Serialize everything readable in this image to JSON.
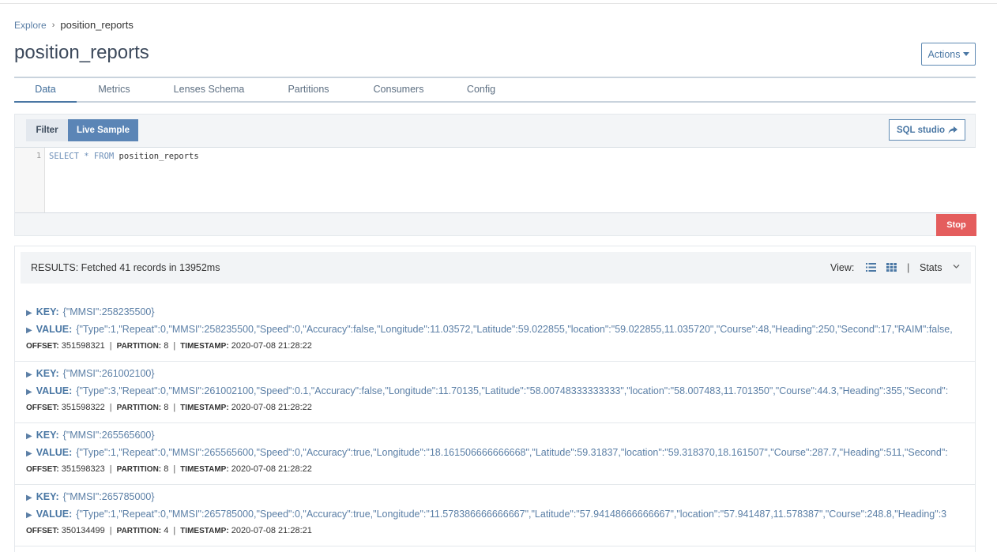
{
  "breadcrumb": {
    "root": "Explore",
    "current": "position_reports"
  },
  "page": {
    "title": "position_reports",
    "actions_label": "Actions"
  },
  "tabs": [
    {
      "label": "Data",
      "active": true
    },
    {
      "label": "Metrics"
    },
    {
      "label": "Lenses Schema"
    },
    {
      "label": "Partitions"
    },
    {
      "label": "Consumers"
    },
    {
      "label": "Config"
    }
  ],
  "query": {
    "filter_label": "Filter",
    "live_sample_label": "Live Sample",
    "sql_studio_label": "SQL studio",
    "line_number": "1",
    "kw_select": "SELECT",
    "star": "*",
    "kw_from": "FROM",
    "table": "position_reports",
    "stop_label": "Stop"
  },
  "results": {
    "summary": "RESULTS: Fetched 41 records in 13952ms",
    "view_label": "View:",
    "separator": "|",
    "stats_label": "Stats",
    "key_label": "KEY:",
    "value_label": "VALUE:",
    "offset_label": "OFFSET:",
    "partition_label": "PARTITION:",
    "timestamp_label": "TIMESTAMP:",
    "records": [
      {
        "key": "{\"MMSI\":258235500}",
        "value": "{\"Type\":1,\"Repeat\":0,\"MMSI\":258235500,\"Speed\":0,\"Accuracy\":false,\"Longitude\":11.03572,\"Latitude\":59.022855,\"location\":\"59.022855,11.035720\",\"Course\":48,\"Heading\":250,\"Second\":17,\"RAIM\":false,",
        "offset": "351598321",
        "partition": "8",
        "timestamp": "2020-07-08 21:28:22"
      },
      {
        "key": "{\"MMSI\":261002100}",
        "value": "{\"Type\":3,\"Repeat\":0,\"MMSI\":261002100,\"Speed\":0.1,\"Accuracy\":false,\"Longitude\":11.70135,\"Latitude\":\"58.00748333333333\",\"location\":\"58.007483,11.701350\",\"Course\":44.3,\"Heading\":355,\"Second\":",
        "offset": "351598322",
        "partition": "8",
        "timestamp": "2020-07-08 21:28:22"
      },
      {
        "key": "{\"MMSI\":265565600}",
        "value": "{\"Type\":1,\"Repeat\":0,\"MMSI\":265565600,\"Speed\":0,\"Accuracy\":true,\"Longitude\":\"18.161506666666668\",\"Latitude\":59.31837,\"location\":\"59.318370,18.161507\",\"Course\":287.7,\"Heading\":511,\"Second\":",
        "offset": "351598323",
        "partition": "8",
        "timestamp": "2020-07-08 21:28:22"
      },
      {
        "key": "{\"MMSI\":265785000}",
        "value": "{\"Type\":1,\"Repeat\":0,\"MMSI\":265785000,\"Speed\":0,\"Accuracy\":true,\"Longitude\":\"11.578386666666667\",\"Latitude\":\"57.94148666666667\",\"location\":\"57.941487,11.578387\",\"Course\":248.8,\"Heading\":3",
        "offset": "350134499",
        "partition": "4",
        "timestamp": "2020-07-08 21:28:21"
      }
    ]
  }
}
